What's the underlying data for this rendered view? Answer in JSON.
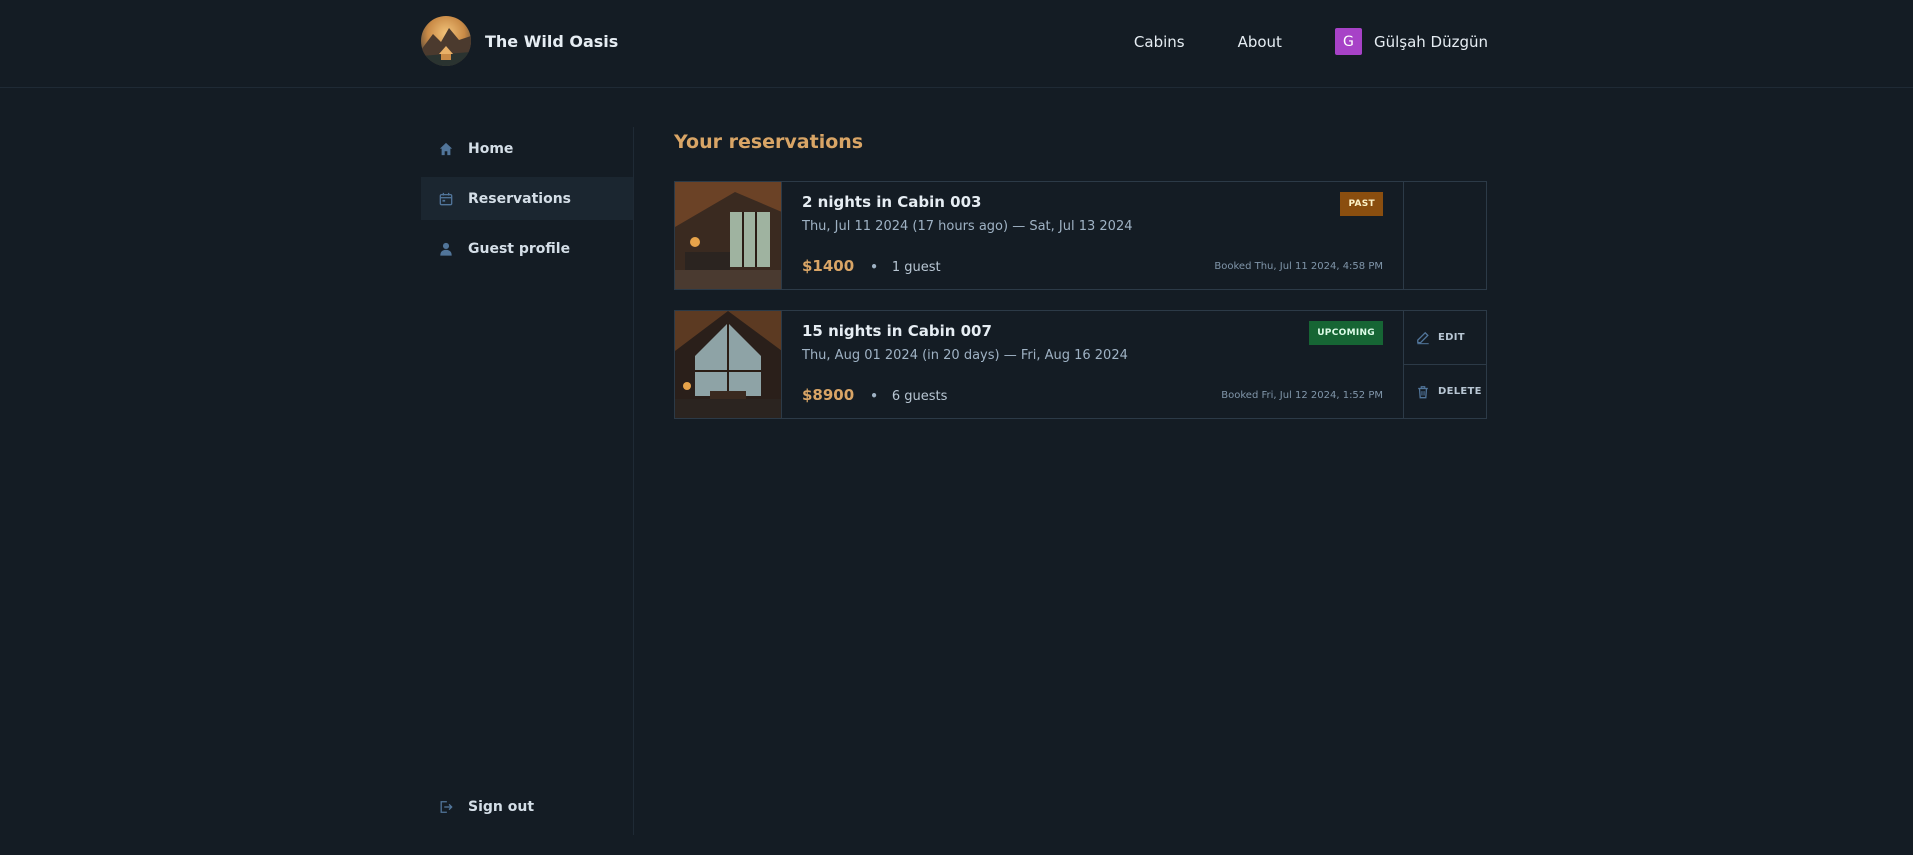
{
  "header": {
    "brand": "The Wild Oasis",
    "nav": {
      "cabins": "Cabins",
      "about": "About"
    },
    "user": {
      "initial": "G",
      "name": "Gülşah Düzgün",
      "avatar_color": "#a742c7"
    }
  },
  "sidebar": {
    "items": [
      {
        "label": "Home",
        "icon": "home-icon"
      },
      {
        "label": "Reservations",
        "icon": "calendar-icon",
        "active": true
      },
      {
        "label": "Guest profile",
        "icon": "user-icon"
      }
    ],
    "sign_out": "Sign out"
  },
  "main": {
    "title": "Your reservations",
    "reservations": [
      {
        "title": "2 nights in Cabin 003",
        "dates": "Thu, Jul 11 2024 (17 hours ago) — Sat, Jul 13 2024",
        "price": "$1400",
        "guests": "1 guest",
        "booked": "Booked Thu, Jul 11 2024, 4:58 PM",
        "status": "PAST"
      },
      {
        "title": "15 nights in Cabin 007",
        "dates": "Thu, Aug 01 2024 (in 20 days) — Fri, Aug 16 2024",
        "price": "$8900",
        "guests": "6 guests",
        "booked": "Booked Fri, Jul 12 2024, 1:52 PM",
        "status": "UPCOMING",
        "actions": {
          "edit": "EDIT",
          "delete": "DELETE"
        }
      }
    ]
  },
  "colors": {
    "background": "#141c24",
    "accent": "#d9a566",
    "past_badge": "#8a4e0f",
    "upcoming_badge": "#166534"
  }
}
